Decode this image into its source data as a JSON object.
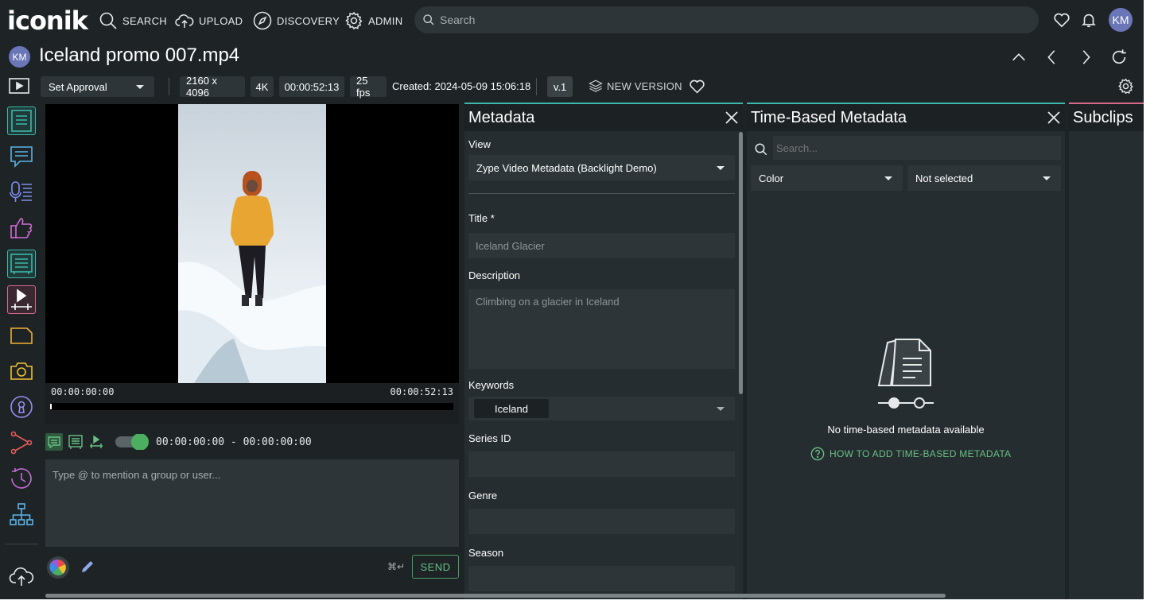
{
  "brand": {
    "logo_text": "iconik",
    "accent": "#3bb8a8",
    "green": "#68c085"
  },
  "nav": {
    "items": [
      {
        "label": "SEARCH",
        "icon": "search-icon"
      },
      {
        "label": "UPLOAD",
        "icon": "cloud-upload-icon"
      },
      {
        "label": "DISCOVERY",
        "icon": "compass-icon"
      },
      {
        "label": "ADMIN",
        "icon": "gear-icon"
      }
    ],
    "search_placeholder": "Search",
    "user_initials": "KM"
  },
  "asset": {
    "owner_initials": "KM",
    "title": "Iceland promo 007.mp4",
    "approval": "Set Approval",
    "resolution": "2160 x 4096",
    "quality": "4K",
    "duration": "00:00:52:13",
    "fps": "25 fps",
    "created": "Created: 2024-05-09 15:06:18",
    "version": "v.1",
    "new_version_label": "NEW VERSION"
  },
  "player": {
    "start_tc": "00:00:00:00",
    "end_tc": "00:00:52:13",
    "range_tc": "00:00:00:00 - 00:00:00:00",
    "comment_placeholder": "Type @ to mention a group or user...",
    "shortcut_hint": "⌘↵",
    "send_label": "SEND"
  },
  "metadata_panel": {
    "title": "Metadata",
    "view_label": "View",
    "view_value": "Zype Video Metadata (Backlight Demo)",
    "fields": {
      "title_label": "Title *",
      "title_placeholder": "Iceland Glacier",
      "description_label": "Description",
      "description_placeholder": "Climbing on a glacier in Iceland",
      "keywords_label": "Keywords",
      "keyword_chip": "Iceland",
      "series_label": "Series ID",
      "genre_label": "Genre",
      "season_label": "Season"
    }
  },
  "tbm_panel": {
    "title": "Time-Based Metadata",
    "search_placeholder": "Search...",
    "filter_1": "Color",
    "filter_2": "Not selected",
    "empty_text": "No time-based metadata available",
    "help_link": "HOW TO ADD TIME-BASED METADATA"
  },
  "subclips_panel": {
    "title": "Subclips"
  }
}
